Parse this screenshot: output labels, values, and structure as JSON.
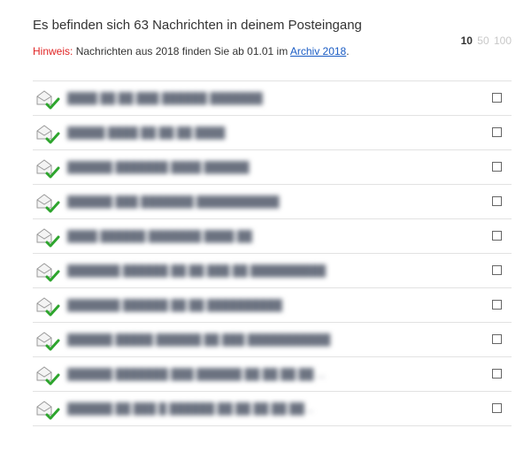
{
  "header": {
    "title": "Es befinden sich 63 Nachrichten in deinem Posteingang",
    "hint_label": "Hinweis:",
    "hint_text": " Nachrichten aus 2018 finden Sie ab 01.01 im ",
    "archive_link": "Archiv 2018",
    "hint_end": "."
  },
  "pager": {
    "options": [
      "10",
      "50",
      "100"
    ],
    "selected": "10"
  },
  "messages": [
    {
      "subject": "████ ██ ██ ███ ██████ ███████"
    },
    {
      "subject": "█████ ████ ██ ██ ██ ████"
    },
    {
      "subject": "██████ ███████ ████ ██████"
    },
    {
      "subject": "██████ ███ ███████ ███████████"
    },
    {
      "subject": "████ ██████ ███████ ████ ██"
    },
    {
      "subject": "███████ ██████ ██ ██ ███ ██ ██████████"
    },
    {
      "subject": "███████ ██████ ██ ██ ██████████"
    },
    {
      "subject": "██████ █████ ██████ ██ ███ ███████████"
    },
    {
      "subject": "██████ ███████ ███ ██████ ██ ██ ██ ██ ..."
    },
    {
      "subject": "██████ ██ ███ █ ██████ ██ ██ ██ ██ ██ .."
    }
  ],
  "colors": {
    "hint_label": "#e02424",
    "link": "#1a5cc4",
    "check": "#2ea52e",
    "divider": "#e2e2e2"
  },
  "icons": {
    "message": "envelope-open-icon",
    "read_mark": "checkmark-icon"
  }
}
